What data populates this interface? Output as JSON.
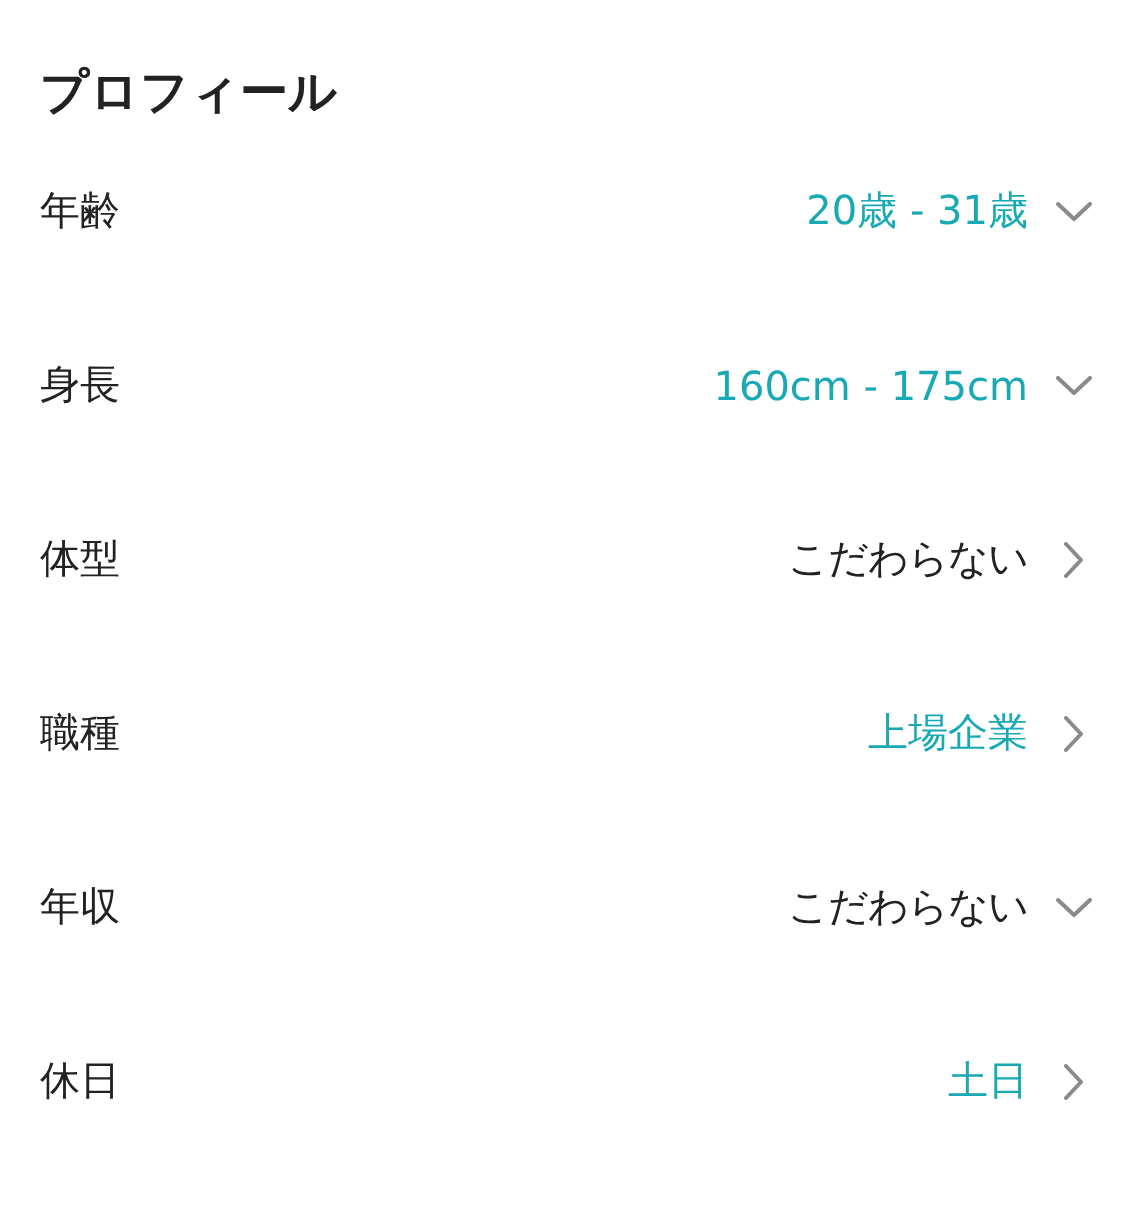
{
  "section_title": "プロフィール",
  "rows": [
    {
      "label": "年齢",
      "value": "20歳 - 31歳",
      "active": true,
      "kind": "dropdown"
    },
    {
      "label": "身長",
      "value": "160cm - 175cm",
      "active": true,
      "kind": "dropdown"
    },
    {
      "label": "体型",
      "value": "こだわらない",
      "active": false,
      "kind": "link"
    },
    {
      "label": "職種",
      "value": "上場企業",
      "active": true,
      "kind": "link"
    },
    {
      "label": "年収",
      "value": "こだわらない",
      "active": false,
      "kind": "dropdown"
    },
    {
      "label": "休日",
      "value": "土日",
      "active": true,
      "kind": "link"
    }
  ]
}
